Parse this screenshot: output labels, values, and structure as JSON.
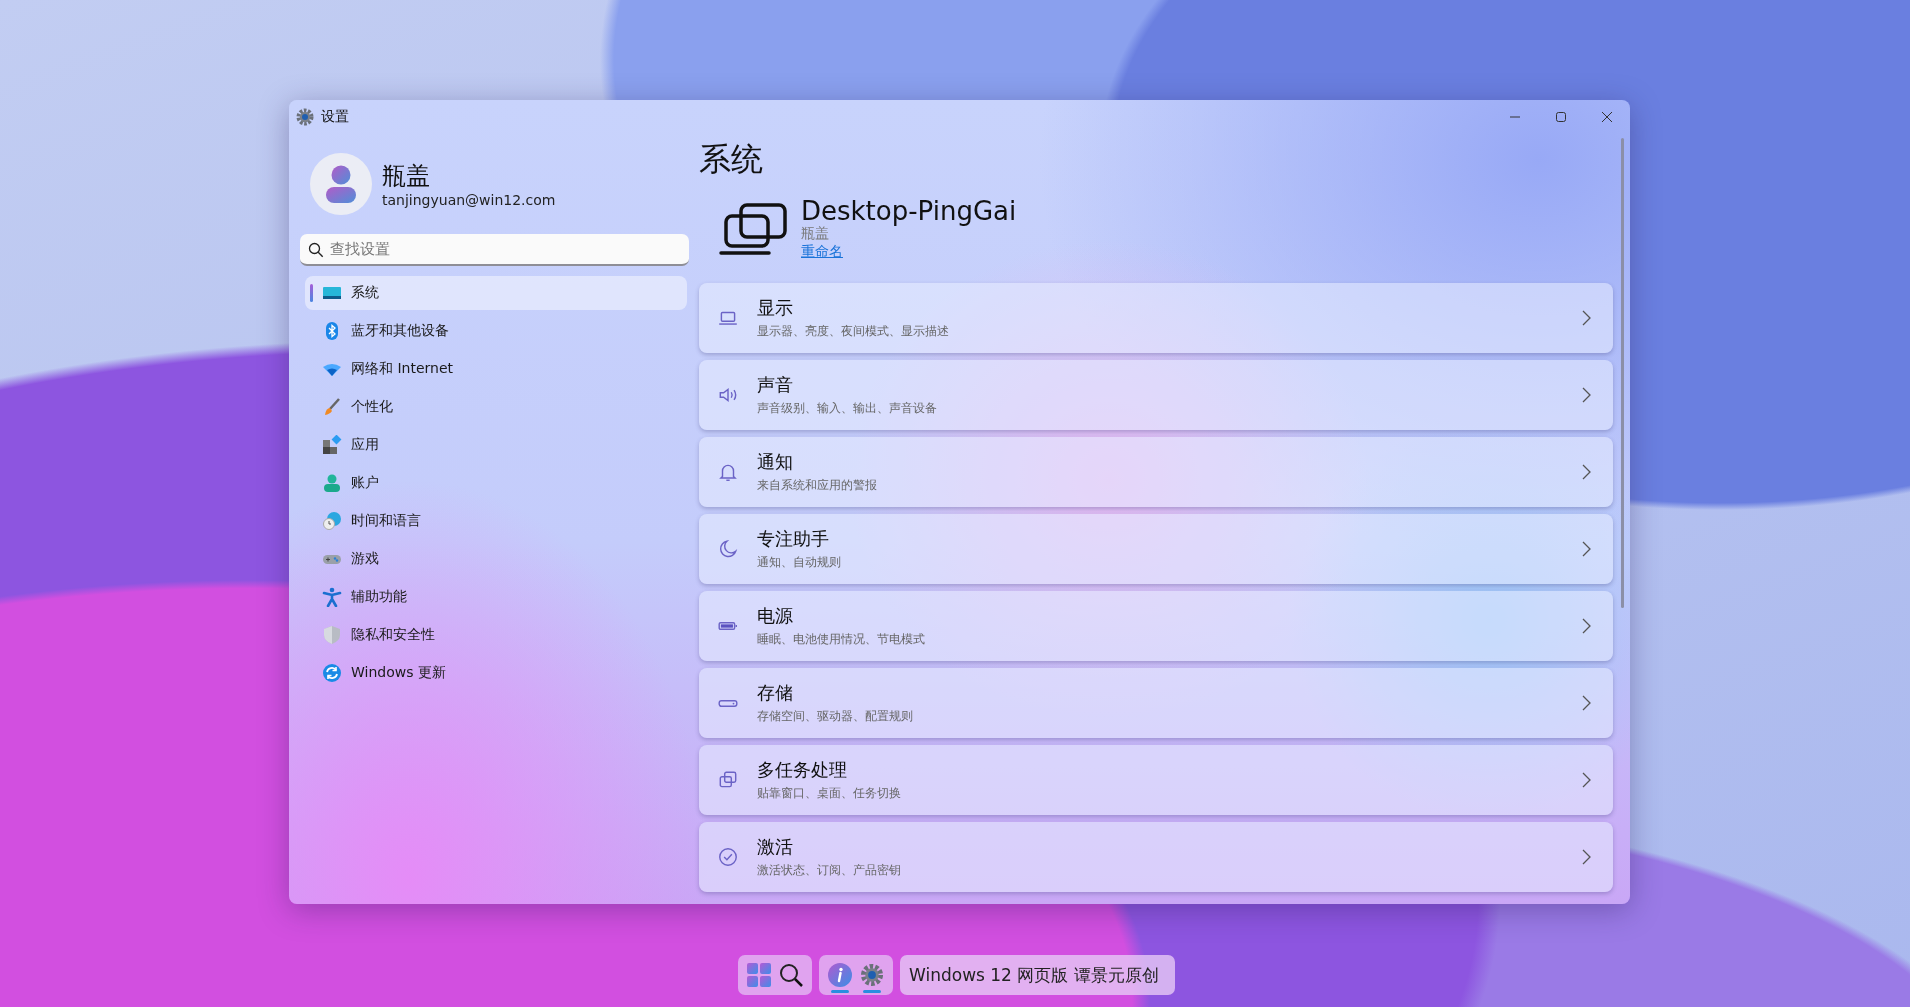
{
  "window": {
    "title": "设置"
  },
  "profile": {
    "name": "瓶盖",
    "email": "tanjingyuan@win12.com"
  },
  "search": {
    "placeholder": "查找设置"
  },
  "sidebar": {
    "items": [
      {
        "kind": "display",
        "label": "系统",
        "selected": true
      },
      {
        "kind": "bluetooth",
        "label": "蓝牙和其他设备",
        "selected": false
      },
      {
        "kind": "wifi",
        "label": "网络和 Internet",
        "selected": false
      },
      {
        "kind": "brush",
        "label": "个性化",
        "selected": false
      },
      {
        "kind": "apps",
        "label": "应用",
        "selected": false
      },
      {
        "kind": "person",
        "label": "账户",
        "selected": false
      },
      {
        "kind": "clock",
        "label": "时间和语言",
        "selected": false
      },
      {
        "kind": "gamepad",
        "label": "游戏",
        "selected": false
      },
      {
        "kind": "access",
        "label": "辅助功能",
        "selected": false
      },
      {
        "kind": "shield",
        "label": "隐私和安全性",
        "selected": false
      },
      {
        "kind": "update",
        "label": "Windows 更新",
        "selected": false
      }
    ]
  },
  "page": {
    "title": "系统",
    "device": {
      "name": "Desktop-PingGai",
      "owner": "瓶盖",
      "rename": "重命名"
    },
    "items": [
      {
        "kind": "laptop",
        "title": "显示",
        "description": "显示器、亮度、夜间模式、显示描述"
      },
      {
        "kind": "speaker",
        "title": "声音",
        "description": "声音级别、输入、输出、声音设备"
      },
      {
        "kind": "bell",
        "title": "通知",
        "description": "来自系统和应用的警报"
      },
      {
        "kind": "moon",
        "title": "专注助手",
        "description": "通知、自动规则"
      },
      {
        "kind": "battery",
        "title": "电源",
        "description": "睡眠、电池使用情况、节电模式"
      },
      {
        "kind": "storage",
        "title": "存储",
        "description": "存储空间、驱动器、配置规则"
      },
      {
        "kind": "multitask",
        "title": "多任务处理",
        "description": "贴靠窗口、桌面、任务切换"
      },
      {
        "kind": "check",
        "title": "激活",
        "description": "激活状态、订阅、产品密钥"
      }
    ]
  },
  "taskbar": {
    "apps": [
      {
        "kind": "info",
        "running": true
      },
      {
        "kind": "settings",
        "running": true
      }
    ],
    "label": "Windows 12 网页版 谭景元原创"
  }
}
